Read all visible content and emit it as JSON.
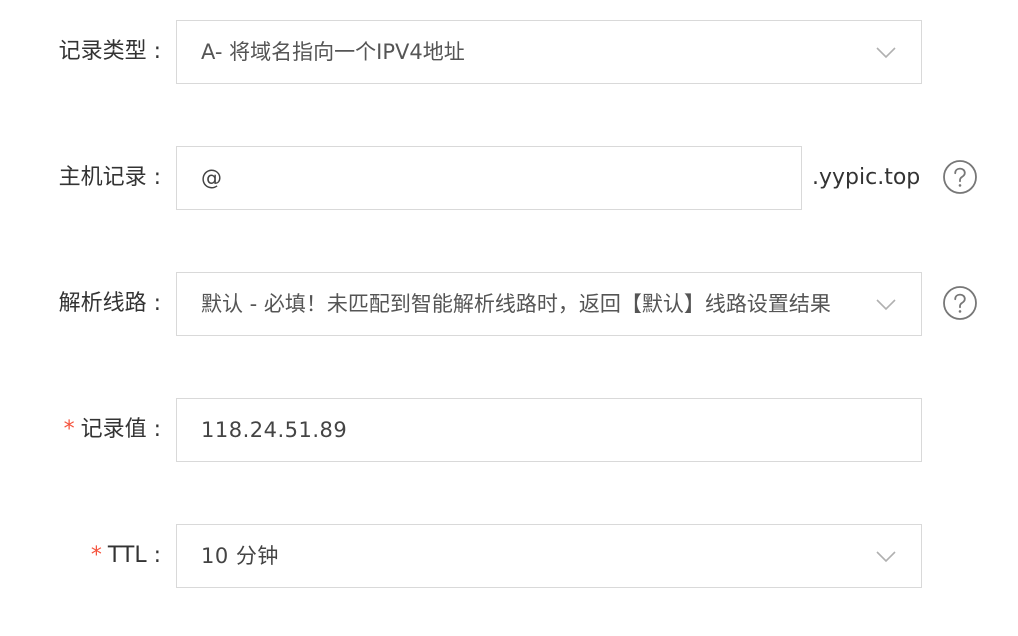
{
  "record_type": {
    "label": "记录类型 :",
    "value": "A- 将域名指向一个IPV4地址",
    "icon": "chevron-down-icon"
  },
  "host_record": {
    "label": "主机记录 :",
    "value": "@",
    "suffix": ".yypic.top",
    "help_icon": "question-circle-icon"
  },
  "resolution_line": {
    "label": "解析线路 :",
    "value": "默认 - 必填！未匹配到智能解析线路时，返回【默认】线路设置结果",
    "icon": "chevron-down-icon",
    "help_icon": "question-circle-icon"
  },
  "record_value": {
    "required_mark": "*",
    "label": "记录值 :",
    "value": "118.24.51.89"
  },
  "ttl": {
    "required_mark": "*",
    "label": "TTL :",
    "value": "10 分钟",
    "icon": "chevron-down-icon"
  },
  "colors": {
    "required": "#f5533d",
    "border": "#d9d9d9",
    "text": "#333333",
    "icon": "#a0a0a0"
  }
}
